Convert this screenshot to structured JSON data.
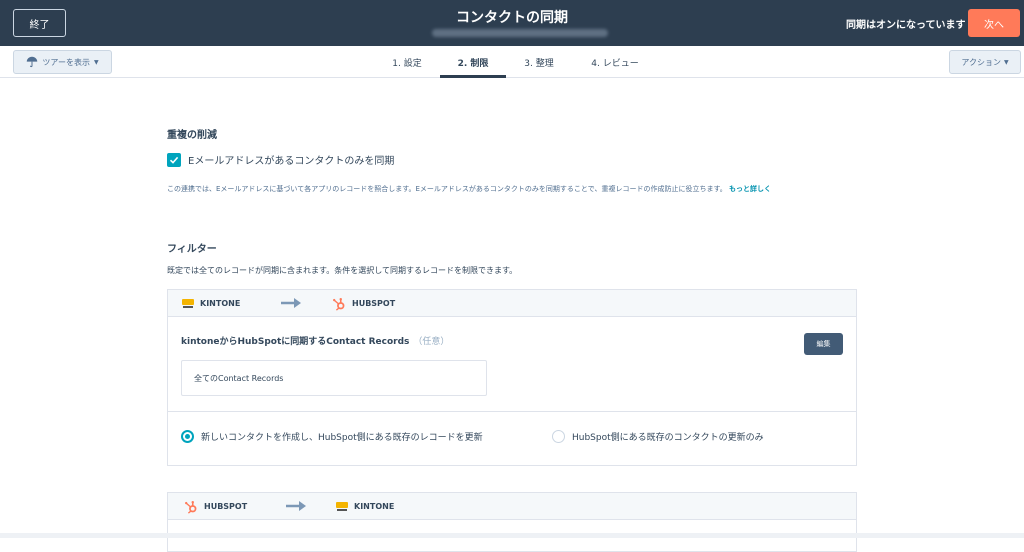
{
  "header": {
    "exit_label": "終了",
    "title": "コンタクトの同期",
    "sync_status": "同期はオンになっています",
    "next_label": "次へ"
  },
  "subbar": {
    "tour_label": "ツアーを表示",
    "action_label": "アクション",
    "tabs": [
      {
        "label": "1. 設定",
        "active": false
      },
      {
        "label": "2. 制限",
        "active": true
      },
      {
        "label": "3. 整理",
        "active": false
      },
      {
        "label": "4. レビュー",
        "active": false
      }
    ]
  },
  "dedup": {
    "title": "重複の削減",
    "checkbox_label": "Eメールアドレスがあるコンタクトのみを同期",
    "checked": true,
    "help_text": "この連携では、Eメールアドレスに基づいて各アプリのレコードを照合します。Eメールアドレスがあるコンタクトのみを同期することで、重複レコードの作成防止に役立ちます。",
    "help_link": "もっと詳しく"
  },
  "filters": {
    "title": "フィルター",
    "description": "既定では全てのレコードが同期に含まれます。条件を選択して同期するレコードを制限できます。",
    "card1": {
      "source_app": "KINTONE",
      "target_app": "HUBSPOT",
      "title": "kintoneからHubSpotに同期するContact Records",
      "optional": "（任意）",
      "edit_label": "編集",
      "filter_value": "全てのContact Records",
      "radio_option_1": "新しいコンタクトを作成し、HubSpot側にある既存のレコードを更新",
      "radio_option_2": "HubSpot側にある既存のコンタクトの更新のみ",
      "selected_option": 1
    },
    "card2": {
      "source_app": "HUBSPOT",
      "target_app": "KINTONE"
    }
  },
  "colors": {
    "header_bg": "#2d3e50",
    "accent_orange": "#ff7a59",
    "accent_teal": "#00a4bd",
    "link": "#0091ae"
  }
}
